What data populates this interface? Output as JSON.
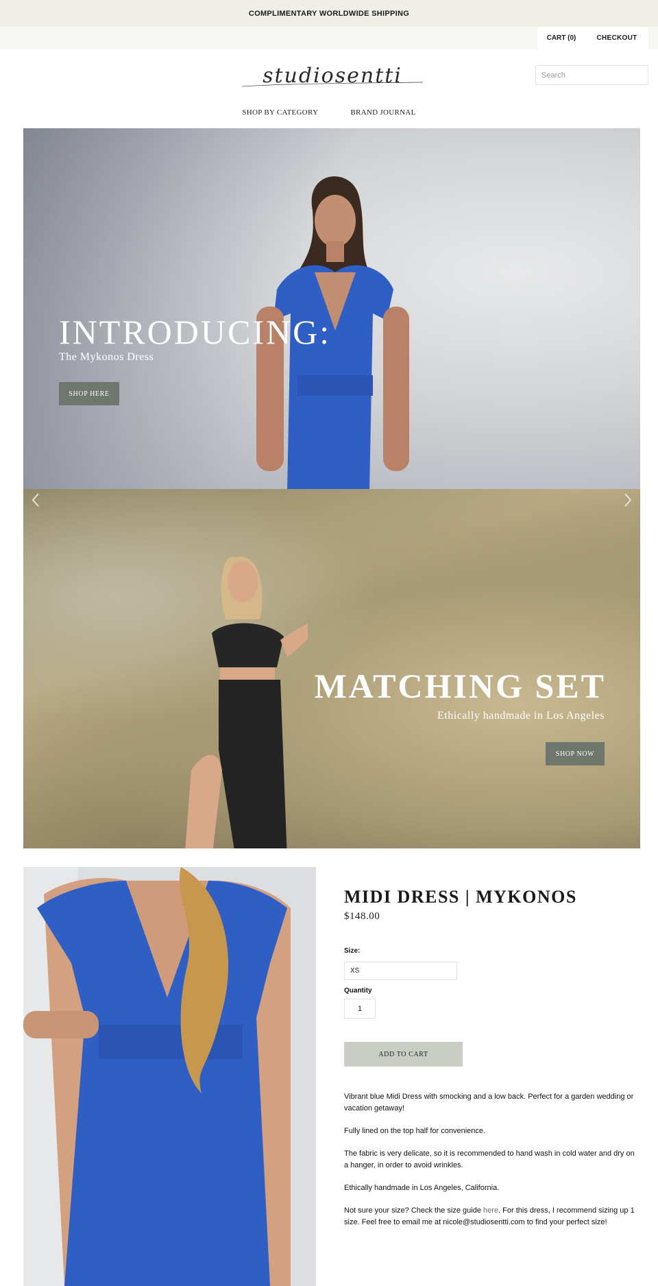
{
  "announcement": "COMPLIMENTARY WORLDWIDE SHIPPING",
  "utility": {
    "cart_label": "CART (0)",
    "checkout_label": "CHECKOUT"
  },
  "header": {
    "logo_text": "studiosentti",
    "search_placeholder": "Search"
  },
  "nav": {
    "items": [
      "SHOP BY CATEGORY",
      "BRAND JOURNAL"
    ]
  },
  "slides": [
    {
      "heading": "INTRODUCING:",
      "subheading": "The Mykonos Dress",
      "button": "SHOP HERE"
    },
    {
      "heading": "MATCHING SET",
      "subheading": "Ethically handmade in Los Angeles",
      "button": "SHOP NOW"
    }
  ],
  "arrows": {
    "left_icon": "chevron-left-icon",
    "right_icon": "chevron-right-icon"
  },
  "product": {
    "title": "MIDI DRESS | MYKONOS",
    "price": "$148.00",
    "size_label": "Size:",
    "size_value": "XS",
    "quantity_label": "Quantity",
    "quantity_value": "1",
    "add_to_cart": "ADD TO CART",
    "description": {
      "p1": "Vibrant blue Midi Dress with smocking and a low back. Perfect for a garden wedding or vacation getaway!",
      "p2": "Fully lined on the top half for convenience.",
      "p3": "The fabric is very delicate, so it is recommended to hand wash in cold water and dry on a hanger, in order to avoid wrinkles.",
      "p4": "Ethically handmade in Los Angeles, California.",
      "p5_before": "Not sure your size? Check the size guide ",
      "p5_link": "here",
      "p5_after": ". For this dress, I recommend sizing up 1 size. Feel free to email me at nicole@studiosentti.com to find your perfect size!"
    }
  },
  "colors": {
    "announcement_bg": "#efefe8",
    "hero_button": "#6f766d",
    "add_to_cart_bg": "#c9cdc5",
    "dress_blue": "#2f5fc4"
  }
}
